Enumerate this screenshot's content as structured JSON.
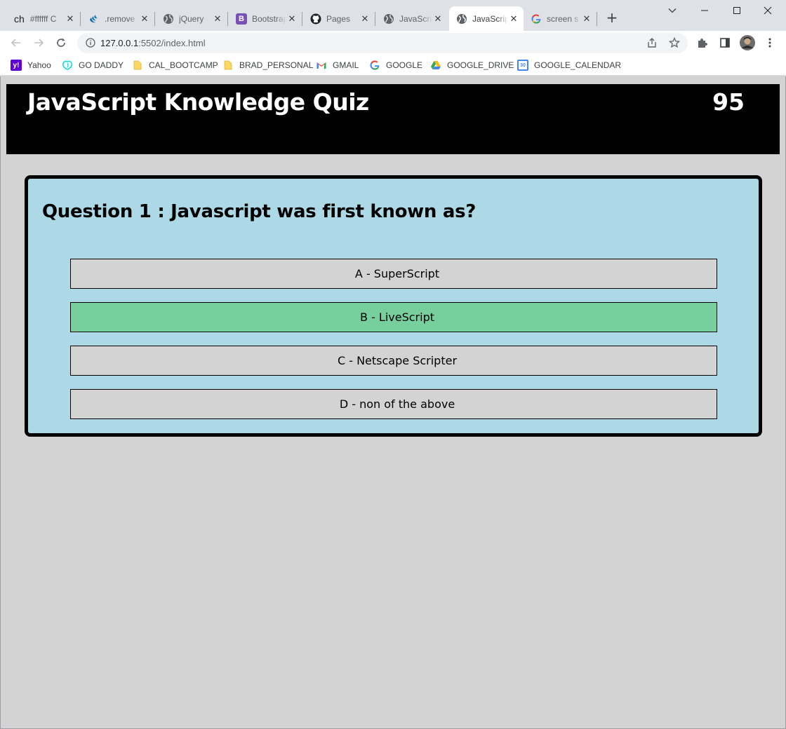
{
  "browser": {
    "tabs": [
      {
        "title": "#ffffff C",
        "favicon": "ch-text-icon",
        "active": false
      },
      {
        "title": ".remove",
        "favicon": "jquery-icon",
        "active": false
      },
      {
        "title": "jQuery",
        "favicon": "globe-icon",
        "active": false
      },
      {
        "title": "Bootstrap",
        "favicon": "bootstrap-icon",
        "active": false
      },
      {
        "title": "Pages",
        "favicon": "github-icon",
        "active": false
      },
      {
        "title": "JavaScript",
        "favicon": "globe-icon",
        "active": false
      },
      {
        "title": "JavaScript",
        "favicon": "globe-icon",
        "active": true
      },
      {
        "title": "screen s",
        "favicon": "google-icon",
        "active": false
      }
    ],
    "first_tab_prefix": "ch",
    "url_host": "127.0.0.1",
    "url_rest": ":5502/index.html",
    "bookmarks": [
      {
        "label": "Yahoo",
        "icon": "yahoo-icon"
      },
      {
        "label": "GO DADDY",
        "icon": "godaddy-icon"
      },
      {
        "label": "CAL_BOOTCAMP",
        "icon": "folder-icon"
      },
      {
        "label": "BRAD_PERSONAL",
        "icon": "folder-icon"
      },
      {
        "label": "GMAIL",
        "icon": "gmail-icon"
      },
      {
        "label": "GOOGLE",
        "icon": "google-icon"
      },
      {
        "label": "GOOGLE_DRIVE",
        "icon": "drive-icon"
      },
      {
        "label": "GOOGLE_CALENDAR",
        "icon": "calendar-icon"
      }
    ],
    "calendar_icon_text": "30",
    "yahoo_icon_text": "y!",
    "bootstrap_icon_text": "B"
  },
  "quiz": {
    "title": "JavaScript Knowledge Quiz",
    "timer": "95",
    "question": "Question 1 : Javascript was first known as?",
    "answers": [
      {
        "label": "A - SuperScript",
        "state": "default"
      },
      {
        "label": "B - LiveScript",
        "state": "correct"
      },
      {
        "label": "C - Netscape Scripter",
        "state": "default"
      },
      {
        "label": "D - non of the above",
        "state": "default"
      }
    ],
    "colors": {
      "page_bg": "#d3d3d3",
      "header_bg": "#000000",
      "card_bg": "#add8e6",
      "answer_bg": "#d3d3d3",
      "correct_bg": "#77cf9e"
    }
  }
}
